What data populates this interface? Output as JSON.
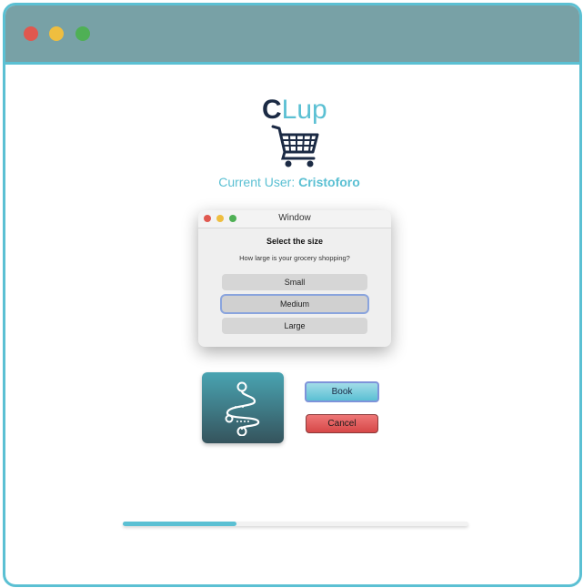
{
  "app": {
    "logo_c": "C",
    "logo_rest": "Lup",
    "current_user_label": "Current User: ",
    "current_user_name": "Cristoforo"
  },
  "dialog": {
    "title": "Window",
    "heading": "Select the size",
    "question": "How large is your grocery shopping?",
    "options": [
      "Small",
      "Medium",
      "Large"
    ],
    "selected": "Medium"
  },
  "actions": {
    "book_label": "Book",
    "cancel_label": "Cancel"
  },
  "progress": {
    "fraction": 0.33
  },
  "icons": {
    "logo_cart": "shopping-cart-icon",
    "route_tile": "route-icon"
  },
  "colors": {
    "accent": "#5bc0d3",
    "titlebar": "#78a1a6",
    "brand_dark": "#1b2a44",
    "cancel": "#d64848"
  }
}
